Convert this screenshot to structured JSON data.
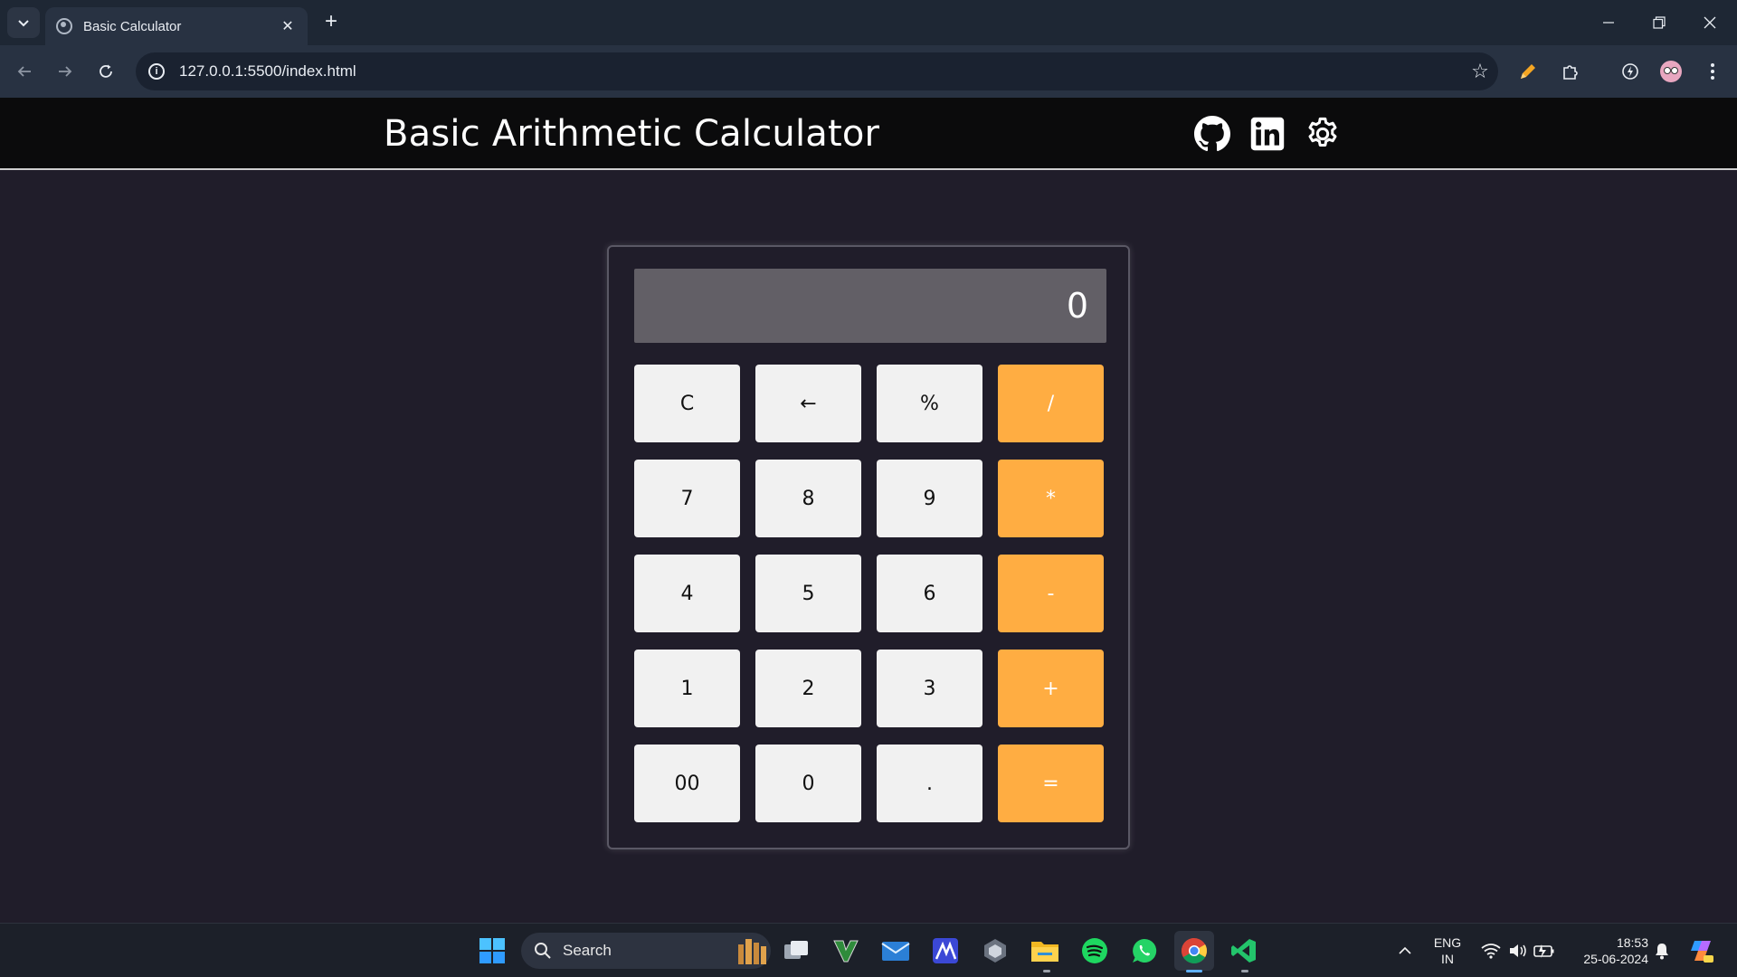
{
  "browser": {
    "tab_title": "Basic Calculator",
    "tab_close": "✕",
    "new_tab": "+",
    "url": "127.0.0.1:5500/index.html",
    "window_controls": {
      "minimize": "—",
      "restore": "❐",
      "close": "✕"
    }
  },
  "page": {
    "title": "Basic Arithmetic Calculator",
    "header_icons": [
      "github-icon",
      "linkedin-icon",
      "gear-icon"
    ]
  },
  "calculator": {
    "display": "0",
    "keys": [
      {
        "label": "C",
        "type": "function"
      },
      {
        "label": "←",
        "type": "function"
      },
      {
        "label": "%",
        "type": "function"
      },
      {
        "label": "/",
        "type": "operator"
      },
      {
        "label": "7",
        "type": "digit"
      },
      {
        "label": "8",
        "type": "digit"
      },
      {
        "label": "9",
        "type": "digit"
      },
      {
        "label": "*",
        "type": "operator"
      },
      {
        "label": "4",
        "type": "digit"
      },
      {
        "label": "5",
        "type": "digit"
      },
      {
        "label": "6",
        "type": "digit"
      },
      {
        "label": "-",
        "type": "operator"
      },
      {
        "label": "1",
        "type": "digit"
      },
      {
        "label": "2",
        "type": "digit"
      },
      {
        "label": "3",
        "type": "digit"
      },
      {
        "label": "+",
        "type": "operator"
      },
      {
        "label": "00",
        "type": "digit"
      },
      {
        "label": "0",
        "type": "digit"
      },
      {
        "label": ".",
        "type": "digit"
      },
      {
        "label": "=",
        "type": "operator"
      }
    ],
    "colors": {
      "key": "#f1f1f1",
      "operator": "#ffad42",
      "display": "#625f66",
      "background": "#201d2a"
    }
  },
  "taskbar": {
    "search_label": "Search",
    "language": "ENG",
    "region": "IN",
    "time": "18:53",
    "date": "25-06-2024"
  }
}
